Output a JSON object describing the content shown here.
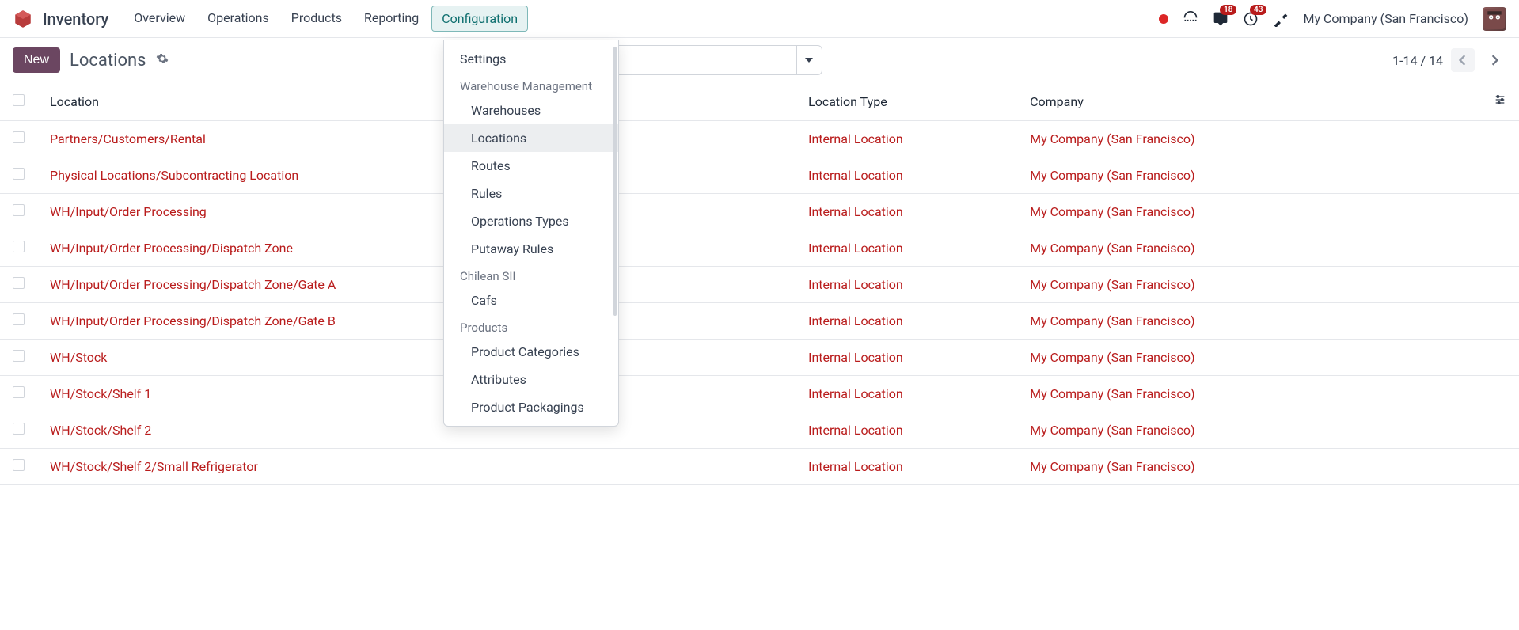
{
  "app": {
    "title": "Inventory"
  },
  "nav": {
    "items": [
      {
        "label": "Overview"
      },
      {
        "label": "Operations"
      },
      {
        "label": "Products"
      },
      {
        "label": "Reporting"
      },
      {
        "label": "Configuration"
      }
    ]
  },
  "topbar": {
    "messages_badge": "18",
    "activities_badge": "43",
    "company": "My Company (San Francisco)"
  },
  "controls": {
    "new_label": "New",
    "page_title": "Locations",
    "pager_text": "1-14 / 14"
  },
  "dropdown": {
    "settings": "Settings",
    "sections": [
      {
        "header": "Warehouse Management",
        "items": [
          "Warehouses",
          "Locations",
          "Routes",
          "Rules",
          "Operations Types",
          "Putaway Rules"
        ]
      },
      {
        "header": "Chilean SII",
        "items": [
          "Cafs"
        ]
      },
      {
        "header": "Products",
        "items": [
          "Product Categories",
          "Attributes",
          "Product Packagings"
        ]
      }
    ]
  },
  "table": {
    "columns": {
      "location": "Location",
      "type": "Location Type",
      "company": "Company"
    },
    "rows": [
      {
        "location": "Partners/Customers/Rental",
        "type": "Internal Location",
        "company": "My Company (San Francisco)"
      },
      {
        "location": "Physical Locations/Subcontracting Location",
        "type": "Internal Location",
        "company": "My Company (San Francisco)"
      },
      {
        "location": "WH/Input/Order Processing",
        "type": "Internal Location",
        "company": "My Company (San Francisco)"
      },
      {
        "location": "WH/Input/Order Processing/Dispatch Zone",
        "type": "Internal Location",
        "company": "My Company (San Francisco)"
      },
      {
        "location": "WH/Input/Order Processing/Dispatch Zone/Gate A",
        "type": "Internal Location",
        "company": "My Company (San Francisco)"
      },
      {
        "location": "WH/Input/Order Processing/Dispatch Zone/Gate B",
        "type": "Internal Location",
        "company": "My Company (San Francisco)"
      },
      {
        "location": "WH/Stock",
        "type": "Internal Location",
        "company": "My Company (San Francisco)"
      },
      {
        "location": "WH/Stock/Shelf 1",
        "type": "Internal Location",
        "company": "My Company (San Francisco)"
      },
      {
        "location": "WH/Stock/Shelf 2",
        "type": "Internal Location",
        "company": "My Company (San Francisco)"
      },
      {
        "location": "WH/Stock/Shelf 2/Small Refrigerator",
        "type": "Internal Location",
        "company": "My Company (San Francisco)"
      }
    ]
  }
}
